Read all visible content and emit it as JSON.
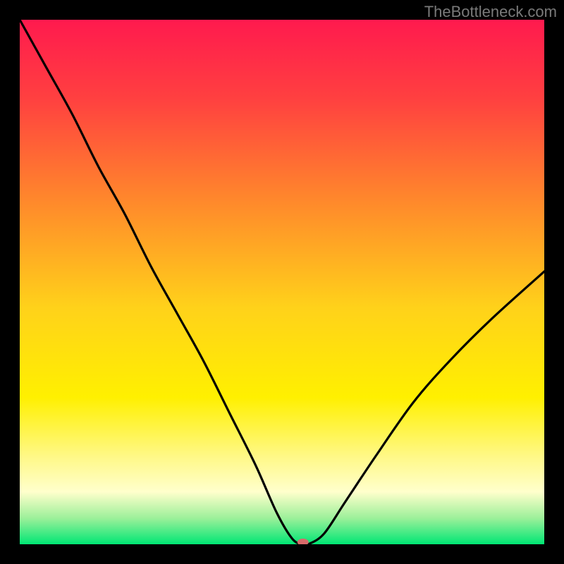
{
  "watermark": "TheBottleneck.com",
  "chart_data": {
    "type": "line",
    "title": "",
    "xlabel": "",
    "ylabel": "",
    "xlim": [
      0,
      100
    ],
    "ylim": [
      0,
      100
    ],
    "background_gradient": {
      "type": "linear-vertical",
      "stops": [
        {
          "pos": 0.0,
          "color": "#ff1a4e"
        },
        {
          "pos": 0.15,
          "color": "#ff4040"
        },
        {
          "pos": 0.35,
          "color": "#ff8a2b"
        },
        {
          "pos": 0.55,
          "color": "#ffd21a"
        },
        {
          "pos": 0.72,
          "color": "#fff000"
        },
        {
          "pos": 0.83,
          "color": "#fff884"
        },
        {
          "pos": 0.9,
          "color": "#ffffcc"
        },
        {
          "pos": 0.95,
          "color": "#9df09a"
        },
        {
          "pos": 1.0,
          "color": "#00e674"
        }
      ]
    },
    "series": [
      {
        "name": "bottleneck-curve",
        "color": "#000000",
        "x": [
          0,
          5,
          10,
          15,
          20,
          25,
          30,
          35,
          40,
          45,
          49,
          52,
          54,
          55,
          58,
          62,
          68,
          75,
          82,
          90,
          100
        ],
        "y": [
          100,
          91,
          82,
          72,
          63,
          53,
          44,
          35,
          25,
          15,
          6,
          1,
          0,
          0,
          2,
          8,
          17,
          27,
          35,
          43,
          52
        ]
      }
    ],
    "marker": {
      "name": "optimal-point",
      "x": 54,
      "y": 0,
      "rx": 8,
      "ry": 5,
      "color": "#d86a6a"
    }
  }
}
